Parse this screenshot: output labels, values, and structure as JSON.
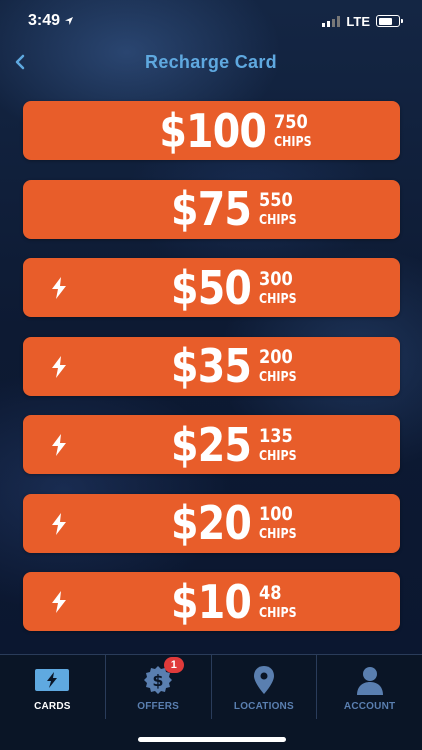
{
  "status": {
    "time": "3:49",
    "carrier": "LTE"
  },
  "header": {
    "title": "Recharge Card"
  },
  "cards": [
    {
      "amount": "$100",
      "chips": "750",
      "chips_label": "CHIPS",
      "bolt": false
    },
    {
      "amount": "$75",
      "chips": "550",
      "chips_label": "CHIPS",
      "bolt": false
    },
    {
      "amount": "$50",
      "chips": "300",
      "chips_label": "CHIPS",
      "bolt": true
    },
    {
      "amount": "$35",
      "chips": "200",
      "chips_label": "CHIPS",
      "bolt": true
    },
    {
      "amount": "$25",
      "chips": "135",
      "chips_label": "CHIPS",
      "bolt": true
    },
    {
      "amount": "$20",
      "chips": "100",
      "chips_label": "CHIPS",
      "bolt": true
    },
    {
      "amount": "$10",
      "chips": "48",
      "chips_label": "CHIPS",
      "bolt": true
    }
  ],
  "tabs": [
    {
      "label": "CARDS",
      "icon": "card-icon",
      "active": true
    },
    {
      "label": "OFFERS",
      "icon": "dollar-badge-icon",
      "active": false,
      "badge": "1"
    },
    {
      "label": "LOCATIONS",
      "icon": "location-pin-icon",
      "active": false
    },
    {
      "label": "ACCOUNT",
      "icon": "person-icon",
      "active": false
    }
  ],
  "colors": {
    "card": "#e85d2a",
    "title": "#5fa9e0",
    "tab_inactive": "#5a7fb0",
    "badge": "#e03a3a",
    "background": "#0c1830"
  }
}
